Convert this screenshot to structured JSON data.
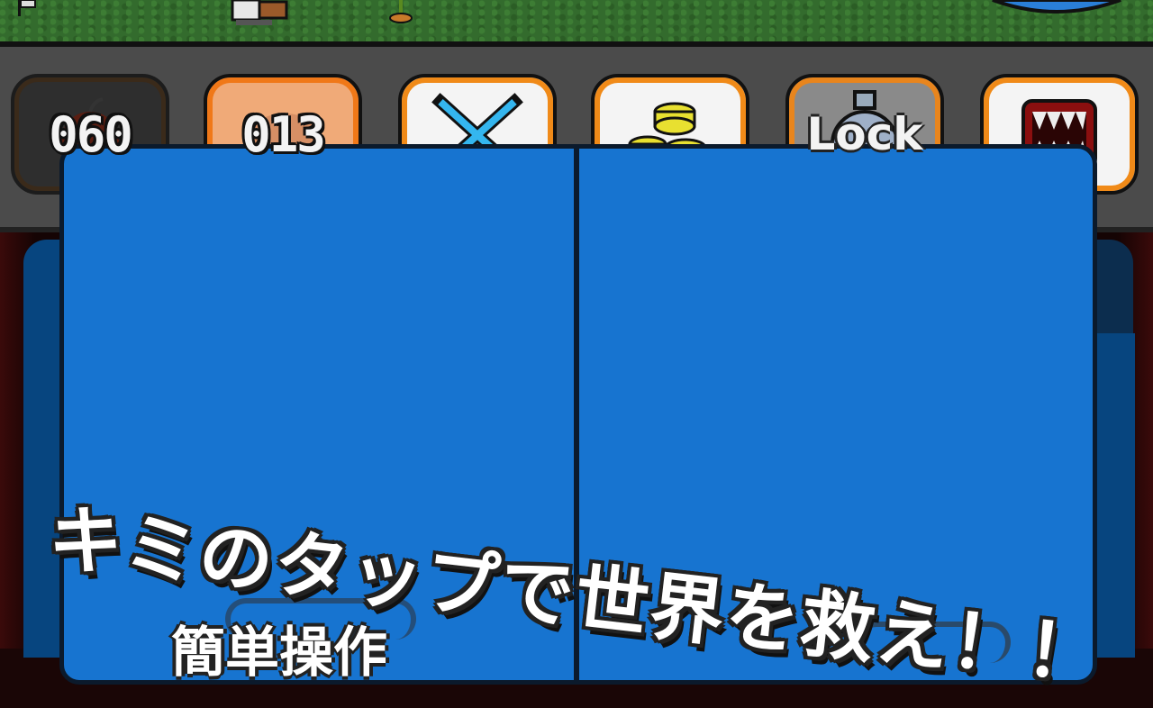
{
  "item_bar": {
    "slots": [
      {
        "id": "bomb-count",
        "value": "060",
        "style": "dark"
      },
      {
        "id": "shield-count",
        "value": "013",
        "style": "orange"
      },
      {
        "id": "crossed-swords",
        "value": "",
        "style": "white"
      },
      {
        "id": "gold-coins",
        "value": "",
        "style": "white"
      },
      {
        "id": "mana-potion",
        "value": "Lock",
        "style": "gray"
      },
      {
        "id": "monster-mouth",
        "value": "",
        "style": "white"
      }
    ]
  },
  "tabs": [
    {
      "id": "tab-split-view",
      "icon": "split-screen-icon",
      "active": true
    },
    {
      "id": "tab-upgrade",
      "icon": "bar-chart-up-icon",
      "active": false
    },
    {
      "id": "tab-add-unit",
      "icon": "tank-plus-icon",
      "active": false
    },
    {
      "id": "tab-log",
      "icon": "document-icon",
      "active": false
    },
    {
      "id": "tab-info",
      "icon": "info-icon",
      "active": false
    }
  ],
  "promo": {
    "headline": "キミのタップで世界を救え！！",
    "subline": "簡単操作"
  },
  "colors": {
    "panel_blue": "#07457f",
    "board_blue": "#1774d0",
    "tab_inactive": "#0c2d4e",
    "slot_border_orange": "#f08a18"
  }
}
